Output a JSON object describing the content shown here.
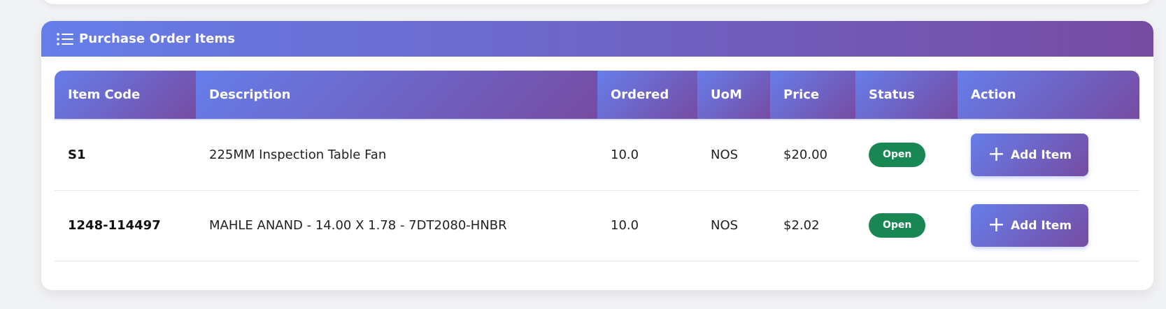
{
  "card": {
    "title": "Purchase Order Items",
    "icon": "list-icon"
  },
  "table": {
    "headers": [
      "Item Code",
      "Description",
      "Ordered",
      "UoM",
      "Price",
      "Status",
      "Action"
    ],
    "rows": [
      {
        "item_code": "S1",
        "description": "225MM Inspection Table Fan",
        "ordered": "10.0",
        "uom": "NOS",
        "price": "$20.00",
        "status": "Open",
        "action": "Add Item"
      },
      {
        "item_code": "1248-114497",
        "description": "MAHLE ANAND - 14.00 X 1.78 - 7DT2080-HNBR",
        "ordered": "10.0",
        "uom": "NOS",
        "price": "$2.02",
        "status": "Open",
        "action": "Add Item"
      }
    ]
  },
  "colors": {
    "gradient_start": "#667eea",
    "gradient_end": "#764ba2",
    "status_open": "#198754",
    "page_bg": "#f1f2f4"
  }
}
